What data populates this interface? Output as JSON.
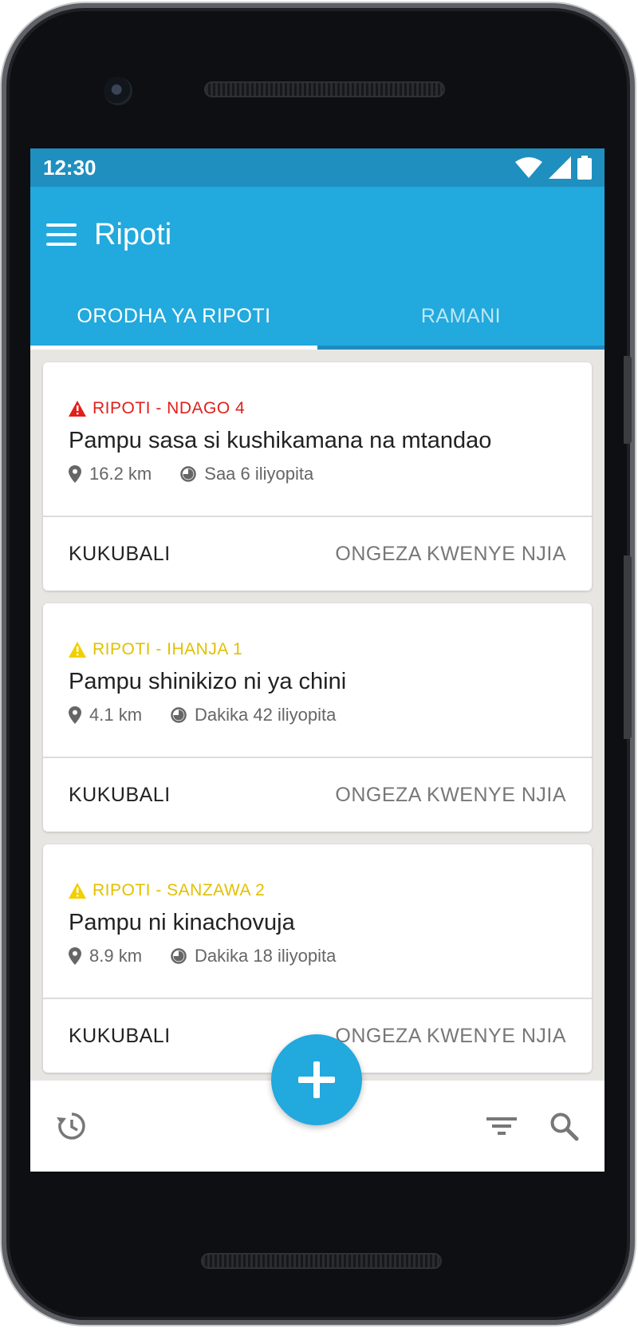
{
  "status_bar": {
    "time": "12:30"
  },
  "app_bar": {
    "title": "Ripoti"
  },
  "tabs": [
    {
      "label": "ORODHA YA RIPOTI",
      "active": true
    },
    {
      "label": "RAMANI",
      "active": false
    }
  ],
  "colors": {
    "primary": "#22a9dd",
    "status_bar": "#1f8fbf",
    "severity_high": "#e0201b",
    "severity_low": "#f2cf00"
  },
  "reports": [
    {
      "tag": "RIPOTI - NDAGO 4",
      "severity": "high",
      "title": "Pampu sasa si kushikamana na mtandao",
      "distance": "16.2 km",
      "time_ago": "Saa 6 iliyopita",
      "accept_label": "KUKUBALI",
      "add_route_label": "ONGEZA KWENYE NJIA"
    },
    {
      "tag": "RIPOTI - IHANJA 1",
      "severity": "low",
      "title": "Pampu shinikizo ni ya chini",
      "distance": "4.1 km",
      "time_ago": "Dakika 42 iliyopita",
      "accept_label": "KUKUBALI",
      "add_route_label": "ONGEZA KWENYE NJIA"
    },
    {
      "tag": "RIPOTI - SANZAWA 2",
      "severity": "low",
      "title": "Pampu ni kinachovuja",
      "distance": "8.9 km",
      "time_ago": "Dakika 18 iliyopita",
      "accept_label": "KUKUBALI",
      "add_route_label": "ONGEZA KWENYE NJIA"
    }
  ],
  "icons": {
    "menu": "menu-icon",
    "history": "history-icon",
    "filter": "filter-icon",
    "search": "search-icon",
    "add": "plus-icon",
    "location": "location-pin-icon",
    "clock": "clock-icon",
    "warning": "warning-icon"
  }
}
